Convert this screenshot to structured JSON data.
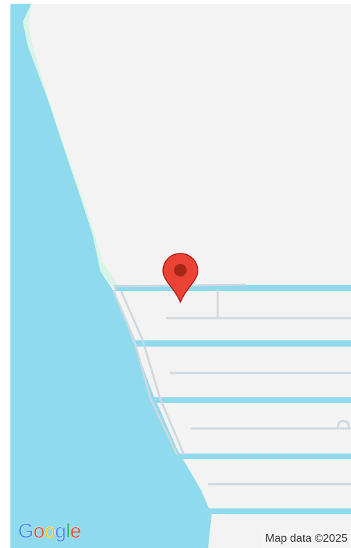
{
  "map": {
    "colors": {
      "water": "#8fdaed",
      "land": "#f3f3f3",
      "coast": "#d7f5e6",
      "street": "#cfd8e0",
      "pin": "#ea4335",
      "pin_dot": "#a52714"
    },
    "marker": {
      "icon": "location-pin-icon"
    },
    "logo": {
      "text": "Google",
      "letters": [
        {
          "char": "G",
          "color": "#4285f4"
        },
        {
          "char": "o",
          "color": "#ea4335"
        },
        {
          "char": "o",
          "color": "#fbbc05"
        },
        {
          "char": "g",
          "color": "#4285f4"
        },
        {
          "char": "l",
          "color": "#34a853"
        },
        {
          "char": "e",
          "color": "#ea4335"
        }
      ]
    },
    "attribution": "Map data ©2025"
  }
}
